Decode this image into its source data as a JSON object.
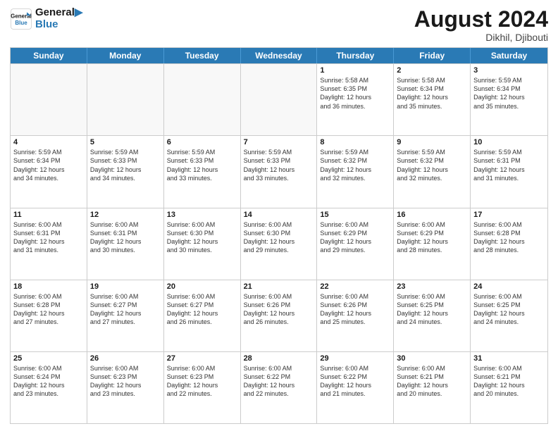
{
  "header": {
    "logo_line1": "General",
    "logo_line2": "Blue",
    "month_year": "August 2024",
    "location": "Dikhil, Djibouti"
  },
  "weekdays": [
    "Sunday",
    "Monday",
    "Tuesday",
    "Wednesday",
    "Thursday",
    "Friday",
    "Saturday"
  ],
  "rows": [
    [
      {
        "day": "",
        "info": "",
        "empty": true
      },
      {
        "day": "",
        "info": "",
        "empty": true
      },
      {
        "day": "",
        "info": "",
        "empty": true
      },
      {
        "day": "",
        "info": "",
        "empty": true
      },
      {
        "day": "1",
        "info": "Sunrise: 5:58 AM\nSunset: 6:35 PM\nDaylight: 12 hours\nand 36 minutes.",
        "empty": false
      },
      {
        "day": "2",
        "info": "Sunrise: 5:58 AM\nSunset: 6:34 PM\nDaylight: 12 hours\nand 35 minutes.",
        "empty": false
      },
      {
        "day": "3",
        "info": "Sunrise: 5:59 AM\nSunset: 6:34 PM\nDaylight: 12 hours\nand 35 minutes.",
        "empty": false
      }
    ],
    [
      {
        "day": "4",
        "info": "Sunrise: 5:59 AM\nSunset: 6:34 PM\nDaylight: 12 hours\nand 34 minutes.",
        "empty": false
      },
      {
        "day": "5",
        "info": "Sunrise: 5:59 AM\nSunset: 6:33 PM\nDaylight: 12 hours\nand 34 minutes.",
        "empty": false
      },
      {
        "day": "6",
        "info": "Sunrise: 5:59 AM\nSunset: 6:33 PM\nDaylight: 12 hours\nand 33 minutes.",
        "empty": false
      },
      {
        "day": "7",
        "info": "Sunrise: 5:59 AM\nSunset: 6:33 PM\nDaylight: 12 hours\nand 33 minutes.",
        "empty": false
      },
      {
        "day": "8",
        "info": "Sunrise: 5:59 AM\nSunset: 6:32 PM\nDaylight: 12 hours\nand 32 minutes.",
        "empty": false
      },
      {
        "day": "9",
        "info": "Sunrise: 5:59 AM\nSunset: 6:32 PM\nDaylight: 12 hours\nand 32 minutes.",
        "empty": false
      },
      {
        "day": "10",
        "info": "Sunrise: 5:59 AM\nSunset: 6:31 PM\nDaylight: 12 hours\nand 31 minutes.",
        "empty": false
      }
    ],
    [
      {
        "day": "11",
        "info": "Sunrise: 6:00 AM\nSunset: 6:31 PM\nDaylight: 12 hours\nand 31 minutes.",
        "empty": false
      },
      {
        "day": "12",
        "info": "Sunrise: 6:00 AM\nSunset: 6:31 PM\nDaylight: 12 hours\nand 30 minutes.",
        "empty": false
      },
      {
        "day": "13",
        "info": "Sunrise: 6:00 AM\nSunset: 6:30 PM\nDaylight: 12 hours\nand 30 minutes.",
        "empty": false
      },
      {
        "day": "14",
        "info": "Sunrise: 6:00 AM\nSunset: 6:30 PM\nDaylight: 12 hours\nand 29 minutes.",
        "empty": false
      },
      {
        "day": "15",
        "info": "Sunrise: 6:00 AM\nSunset: 6:29 PM\nDaylight: 12 hours\nand 29 minutes.",
        "empty": false
      },
      {
        "day": "16",
        "info": "Sunrise: 6:00 AM\nSunset: 6:29 PM\nDaylight: 12 hours\nand 28 minutes.",
        "empty": false
      },
      {
        "day": "17",
        "info": "Sunrise: 6:00 AM\nSunset: 6:28 PM\nDaylight: 12 hours\nand 28 minutes.",
        "empty": false
      }
    ],
    [
      {
        "day": "18",
        "info": "Sunrise: 6:00 AM\nSunset: 6:28 PM\nDaylight: 12 hours\nand 27 minutes.",
        "empty": false
      },
      {
        "day": "19",
        "info": "Sunrise: 6:00 AM\nSunset: 6:27 PM\nDaylight: 12 hours\nand 27 minutes.",
        "empty": false
      },
      {
        "day": "20",
        "info": "Sunrise: 6:00 AM\nSunset: 6:27 PM\nDaylight: 12 hours\nand 26 minutes.",
        "empty": false
      },
      {
        "day": "21",
        "info": "Sunrise: 6:00 AM\nSunset: 6:26 PM\nDaylight: 12 hours\nand 26 minutes.",
        "empty": false
      },
      {
        "day": "22",
        "info": "Sunrise: 6:00 AM\nSunset: 6:26 PM\nDaylight: 12 hours\nand 25 minutes.",
        "empty": false
      },
      {
        "day": "23",
        "info": "Sunrise: 6:00 AM\nSunset: 6:25 PM\nDaylight: 12 hours\nand 24 minutes.",
        "empty": false
      },
      {
        "day": "24",
        "info": "Sunrise: 6:00 AM\nSunset: 6:25 PM\nDaylight: 12 hours\nand 24 minutes.",
        "empty": false
      }
    ],
    [
      {
        "day": "25",
        "info": "Sunrise: 6:00 AM\nSunset: 6:24 PM\nDaylight: 12 hours\nand 23 minutes.",
        "empty": false
      },
      {
        "day": "26",
        "info": "Sunrise: 6:00 AM\nSunset: 6:23 PM\nDaylight: 12 hours\nand 23 minutes.",
        "empty": false
      },
      {
        "day": "27",
        "info": "Sunrise: 6:00 AM\nSunset: 6:23 PM\nDaylight: 12 hours\nand 22 minutes.",
        "empty": false
      },
      {
        "day": "28",
        "info": "Sunrise: 6:00 AM\nSunset: 6:22 PM\nDaylight: 12 hours\nand 22 minutes.",
        "empty": false
      },
      {
        "day": "29",
        "info": "Sunrise: 6:00 AM\nSunset: 6:22 PM\nDaylight: 12 hours\nand 21 minutes.",
        "empty": false
      },
      {
        "day": "30",
        "info": "Sunrise: 6:00 AM\nSunset: 6:21 PM\nDaylight: 12 hours\nand 20 minutes.",
        "empty": false
      },
      {
        "day": "31",
        "info": "Sunrise: 6:00 AM\nSunset: 6:21 PM\nDaylight: 12 hours\nand 20 minutes.",
        "empty": false
      }
    ]
  ]
}
